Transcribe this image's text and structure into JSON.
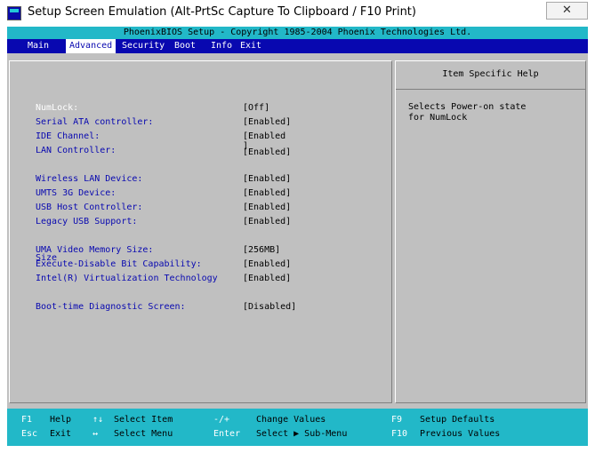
{
  "window": {
    "title": "Setup Screen Emulation (Alt-PrtSc Capture To Clipboard / F10 Print)",
    "close_label": "✕"
  },
  "bios": {
    "header": "PhoenixBIOS Setup - Copyright 1985-2004 Phoenix Technologies Ltd.",
    "menu": [
      "Main",
      "Advanced",
      "Security",
      "Boot",
      "Info",
      "Exit"
    ],
    "active_menu": "Advanced",
    "options": [
      {
        "label": "NumLock:",
        "value": "[Off]"
      },
      {
        "label": "Serial ATA controller:",
        "value": "[Enabled]"
      },
      {
        "label": "IDE Channel:",
        "value": "[Enabled"
      },
      {
        "label": "LAN Controller:",
        "value": "]"
      },
      {
        "label": "Wireless LAN Device:",
        "value": "[Enabled]"
      },
      {
        "label": "UMTS 3G Device:",
        "value": "[Enabled]"
      },
      {
        "label": "USB Host Controller:",
        "value": "[Enabled]"
      },
      {
        "label": "Legacy USB Support:",
        "value": "[Enabled]"
      },
      {
        "label": "UMA Video Memory Size:",
        "value": "[256MB]"
      },
      {
        "label": "Execute-Disable Bit Capability:",
        "value": "[Enabled]"
      },
      {
        "label": "Intel(R) Virtualization Technology",
        "value": "[Enabled]"
      },
      {
        "label": "Boot-time Diagnostic Screen:",
        "value": "[Disabled]"
      }
    ],
    "overlap_texts": {
      "lan_value_ghost": "[Enabled]",
      "uma_ghost": "Size"
    },
    "help": {
      "title": "Item Specific Help",
      "text": "Selects Power-on state\nfor NumLock"
    },
    "footer": {
      "row1": {
        "k1": "F1",
        "d1": "Help",
        "k2": "↑↓",
        "d2": "Select Item",
        "k3": "-/+",
        "d3": "Change Values",
        "k4": "F9",
        "d4": "Setup Defaults"
      },
      "row2": {
        "k1": "Esc",
        "d1": "Exit",
        "k2": "↔",
        "d2": "Select Menu",
        "k3": "Enter",
        "d3": "Select ▶ Sub-Menu",
        "k4": "F10",
        "d4": "Previous Values"
      }
    },
    "colors": {
      "header_bg": "#22b8c8",
      "menubar_bg": "#0808b0",
      "panel_bg": "#c0c0c0",
      "label_blue": "#0808b0"
    }
  }
}
